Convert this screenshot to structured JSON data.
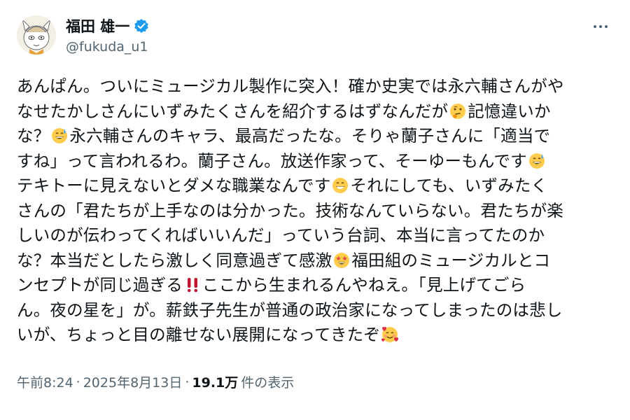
{
  "author": {
    "display_name": "福田 雄一",
    "handle": "@fukuda_u1",
    "verified_color": "#1d9bf0"
  },
  "tweet": {
    "lines": [
      [
        "あんぱん。ついにミュージカル製作に突入！確か史実では永六輔さんがや"
      ],
      [
        "なせたかしさんにいずみたくさんを紹介するはずなんだが",
        "emoji:thinking-face",
        "記憶違いか"
      ],
      [
        "な？",
        "emoji:grinning-sweat",
        "永六輔さんのキャラ、最高だったな。そりゃ蘭子さんに「適当で"
      ],
      [
        "すね」って言われるわ。蘭子さん。放送作家って、そーゆーもんです",
        "emoji:grinning-sweat"
      ],
      [
        "テキトーに見えないとダメな職業なんです",
        "emoji:beaming-face",
        "それにしても、いずみたく"
      ],
      [
        "さんの「君たちが上手なのは分かった。技術なんていらない。君たちが楽"
      ],
      [
        "しいのが伝わってくればいいんだ」っていう台詞、本当に言ってたのか"
      ],
      [
        "な？本当だとしたら激しく同意過ぎて感激",
        "emoji:star-struck",
        "福田組のミュージカルとコ"
      ],
      [
        "ンセプトが同じ過ぎる",
        "emoji:double-exclamation",
        "ここから生まれるんやねえ。「見上げてごら"
      ],
      [
        "ん。夜の星を」が。薪鉄子先生が普通の政治家になってしまったのは悲し"
      ],
      [
        "いが、ちょっと目の離せない展開になってきたぞ",
        "emoji:smiling-hearts"
      ]
    ]
  },
  "meta": {
    "time": "午前8:24",
    "separator1": "·",
    "date": "2025年8月13日",
    "separator2": "·",
    "views_count": "19.1万",
    "views_label": "件の表示"
  },
  "more_icon": "more-horizontal-icon"
}
